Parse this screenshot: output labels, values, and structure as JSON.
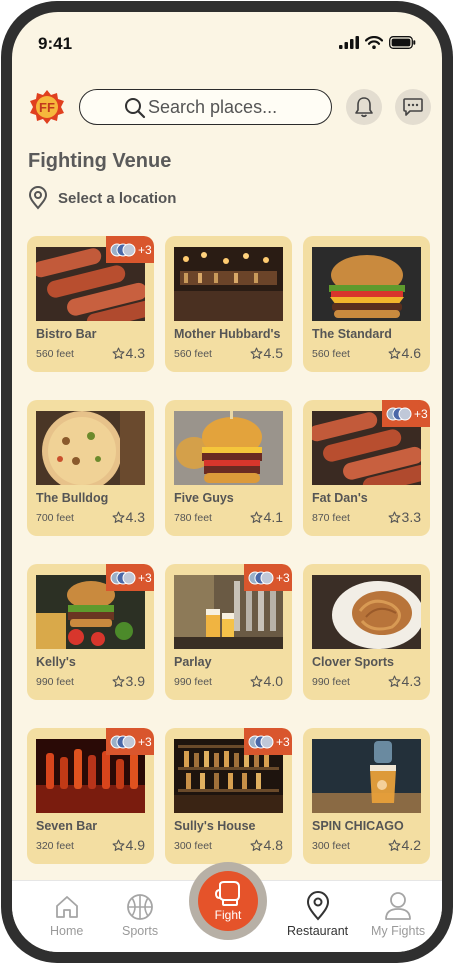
{
  "status_bar": {
    "time": "9:41"
  },
  "header": {
    "search_placeholder": "Search places...",
    "title": "Fighting Venue",
    "location_label": "Select a location"
  },
  "venues": [
    {
      "name": "Bistro Bar",
      "distance": "560 feet",
      "rating": "4.3",
      "extra": "+3",
      "photo": "sausages"
    },
    {
      "name": "Mother Hubbard's",
      "distance": "560 feet",
      "rating": "4.5",
      "extra": null,
      "photo": "bar"
    },
    {
      "name": "The Standard",
      "distance": "560 feet",
      "rating": "4.6",
      "extra": null,
      "photo": "burger"
    },
    {
      "name": "The Bulldog",
      "distance": "700 feet",
      "rating": "4.3",
      "extra": null,
      "photo": "pizza"
    },
    {
      "name": "Five Guys",
      "distance": "780 feet",
      "rating": "4.1",
      "extra": null,
      "photo": "burger2"
    },
    {
      "name": "Fat Dan's",
      "distance": "870 feet",
      "rating": "3.3",
      "extra": "+3",
      "photo": "sausages"
    },
    {
      "name": "Kelly's",
      "distance": "990 feet",
      "rating": "3.9",
      "extra": "+3",
      "photo": "burgerplate"
    },
    {
      "name": "Parlay",
      "distance": "990 feet",
      "rating": "4.0",
      "extra": "+3",
      "photo": "beer"
    },
    {
      "name": "Clover Sports",
      "distance": "990 feet",
      "rating": "4.3",
      "extra": null,
      "photo": "pasta"
    },
    {
      "name": "Seven Bar",
      "distance": "320 feet",
      "rating": "4.9",
      "extra": "+3",
      "photo": "bottles"
    },
    {
      "name": "Sully's House",
      "distance": "300 feet",
      "rating": "4.8",
      "extra": "+3",
      "photo": "shelf"
    },
    {
      "name": "SPIN CHICAGO",
      "distance": "300 feet",
      "rating": "4.2",
      "extra": null,
      "photo": "cocktail"
    }
  ],
  "nav": {
    "home": "Home",
    "sports": "Sports",
    "fight": "Fight",
    "restaurant": "Restaurant",
    "my_fights": "My Fights",
    "active": "restaurant"
  },
  "colors": {
    "background": "#fbf5e4",
    "card": "#f3dea2",
    "accent": "#e5532a",
    "badge": "#d9562d"
  }
}
